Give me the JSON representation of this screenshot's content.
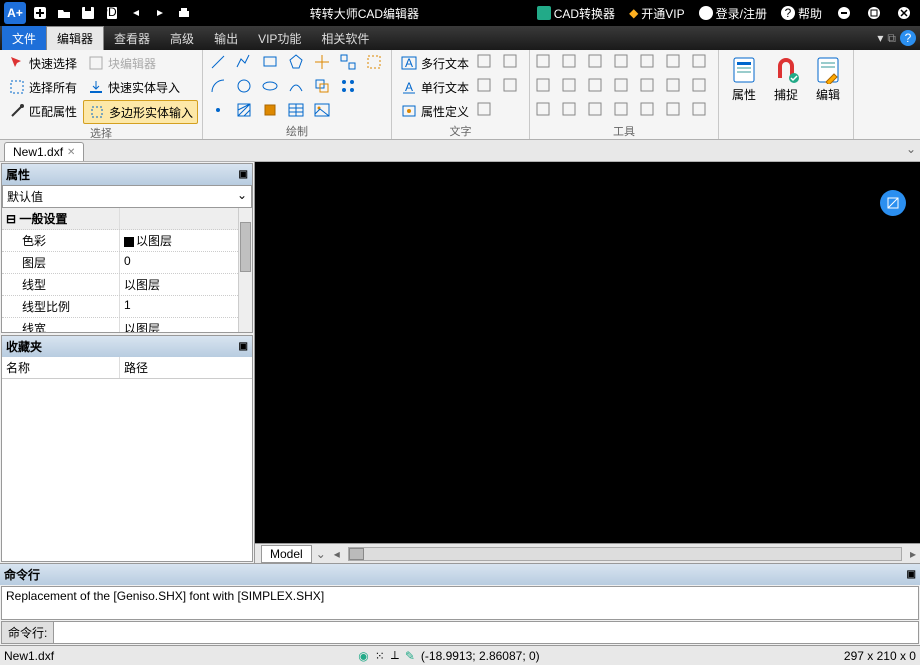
{
  "title": "转转大师CAD编辑器",
  "titlebar_links": {
    "converter": "CAD转换器",
    "vip": "开通VIP",
    "login": "登录/注册",
    "help": "帮助"
  },
  "menu": {
    "file": "文件",
    "editor": "编辑器",
    "viewer": "查看器",
    "advanced": "高级",
    "output": "输出",
    "vip": "VIP功能",
    "related": "相关软件"
  },
  "ribbon": {
    "select": {
      "quick": "快速选择",
      "block": "块编辑器",
      "all": "选择所有",
      "import": "快速实体导入",
      "match": "匹配属性",
      "poly": "多边形实体输入",
      "label": "选择"
    },
    "draw_label": "绘制",
    "text": {
      "multi": "多行文本",
      "single": "单行文本",
      "attr": "属性定义",
      "label": "文字"
    },
    "tools_label": "工具",
    "big": {
      "props": "属性",
      "snap": "捕捉",
      "edit": "编辑"
    }
  },
  "filetab": "New1.dxf",
  "props": {
    "title": "属性",
    "default": "默认值",
    "general": "一般设置",
    "rows": [
      {
        "k": "色彩",
        "v": "以图层",
        "blk": true
      },
      {
        "k": "图层",
        "v": "0"
      },
      {
        "k": "线型",
        "v": "以图层"
      },
      {
        "k": "线型比例",
        "v": "1"
      },
      {
        "k": "线宽",
        "v": "以图层"
      }
    ]
  },
  "fav": {
    "title": "收藏夹",
    "name": "名称",
    "path": "路径"
  },
  "model": "Model",
  "cmd": {
    "title": "命令行",
    "out": "Replacement of the [Geniso.SHX] font with [SIMPLEX.SHX]",
    "label": "命令行:"
  },
  "status": {
    "file": "New1.dxf",
    "coords": "(-18.9913; 2.86087; 0)",
    "dims": "297 x 210 x 0"
  }
}
